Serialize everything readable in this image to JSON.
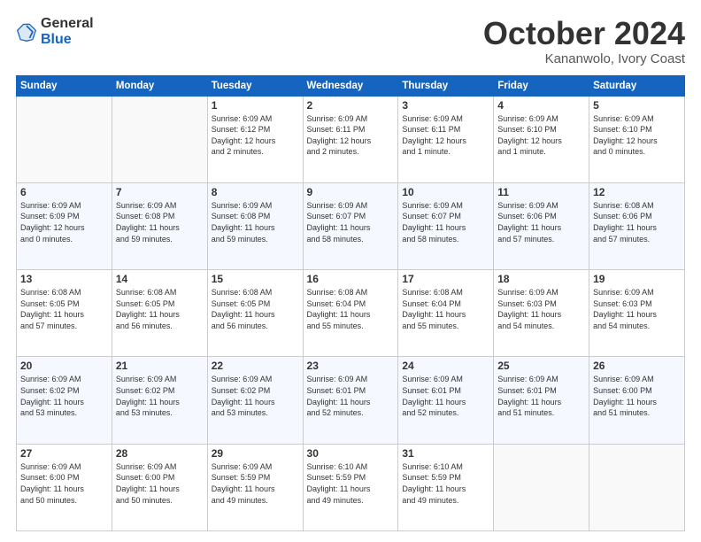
{
  "header": {
    "logo_line1": "General",
    "logo_line2": "Blue",
    "month": "October 2024",
    "location": "Kananwolo, Ivory Coast"
  },
  "days_of_week": [
    "Sunday",
    "Monday",
    "Tuesday",
    "Wednesday",
    "Thursday",
    "Friday",
    "Saturday"
  ],
  "weeks": [
    [
      {
        "day": "",
        "info": ""
      },
      {
        "day": "",
        "info": ""
      },
      {
        "day": "1",
        "info": "Sunrise: 6:09 AM\nSunset: 6:12 PM\nDaylight: 12 hours\nand 2 minutes."
      },
      {
        "day": "2",
        "info": "Sunrise: 6:09 AM\nSunset: 6:11 PM\nDaylight: 12 hours\nand 2 minutes."
      },
      {
        "day": "3",
        "info": "Sunrise: 6:09 AM\nSunset: 6:11 PM\nDaylight: 12 hours\nand 1 minute."
      },
      {
        "day": "4",
        "info": "Sunrise: 6:09 AM\nSunset: 6:10 PM\nDaylight: 12 hours\nand 1 minute."
      },
      {
        "day": "5",
        "info": "Sunrise: 6:09 AM\nSunset: 6:10 PM\nDaylight: 12 hours\nand 0 minutes."
      }
    ],
    [
      {
        "day": "6",
        "info": "Sunrise: 6:09 AM\nSunset: 6:09 PM\nDaylight: 12 hours\nand 0 minutes."
      },
      {
        "day": "7",
        "info": "Sunrise: 6:09 AM\nSunset: 6:08 PM\nDaylight: 11 hours\nand 59 minutes."
      },
      {
        "day": "8",
        "info": "Sunrise: 6:09 AM\nSunset: 6:08 PM\nDaylight: 11 hours\nand 59 minutes."
      },
      {
        "day": "9",
        "info": "Sunrise: 6:09 AM\nSunset: 6:07 PM\nDaylight: 11 hours\nand 58 minutes."
      },
      {
        "day": "10",
        "info": "Sunrise: 6:09 AM\nSunset: 6:07 PM\nDaylight: 11 hours\nand 58 minutes."
      },
      {
        "day": "11",
        "info": "Sunrise: 6:09 AM\nSunset: 6:06 PM\nDaylight: 11 hours\nand 57 minutes."
      },
      {
        "day": "12",
        "info": "Sunrise: 6:08 AM\nSunset: 6:06 PM\nDaylight: 11 hours\nand 57 minutes."
      }
    ],
    [
      {
        "day": "13",
        "info": "Sunrise: 6:08 AM\nSunset: 6:05 PM\nDaylight: 11 hours\nand 57 minutes."
      },
      {
        "day": "14",
        "info": "Sunrise: 6:08 AM\nSunset: 6:05 PM\nDaylight: 11 hours\nand 56 minutes."
      },
      {
        "day": "15",
        "info": "Sunrise: 6:08 AM\nSunset: 6:05 PM\nDaylight: 11 hours\nand 56 minutes."
      },
      {
        "day": "16",
        "info": "Sunrise: 6:08 AM\nSunset: 6:04 PM\nDaylight: 11 hours\nand 55 minutes."
      },
      {
        "day": "17",
        "info": "Sunrise: 6:08 AM\nSunset: 6:04 PM\nDaylight: 11 hours\nand 55 minutes."
      },
      {
        "day": "18",
        "info": "Sunrise: 6:09 AM\nSunset: 6:03 PM\nDaylight: 11 hours\nand 54 minutes."
      },
      {
        "day": "19",
        "info": "Sunrise: 6:09 AM\nSunset: 6:03 PM\nDaylight: 11 hours\nand 54 minutes."
      }
    ],
    [
      {
        "day": "20",
        "info": "Sunrise: 6:09 AM\nSunset: 6:02 PM\nDaylight: 11 hours\nand 53 minutes."
      },
      {
        "day": "21",
        "info": "Sunrise: 6:09 AM\nSunset: 6:02 PM\nDaylight: 11 hours\nand 53 minutes."
      },
      {
        "day": "22",
        "info": "Sunrise: 6:09 AM\nSunset: 6:02 PM\nDaylight: 11 hours\nand 53 minutes."
      },
      {
        "day": "23",
        "info": "Sunrise: 6:09 AM\nSunset: 6:01 PM\nDaylight: 11 hours\nand 52 minutes."
      },
      {
        "day": "24",
        "info": "Sunrise: 6:09 AM\nSunset: 6:01 PM\nDaylight: 11 hours\nand 52 minutes."
      },
      {
        "day": "25",
        "info": "Sunrise: 6:09 AM\nSunset: 6:01 PM\nDaylight: 11 hours\nand 51 minutes."
      },
      {
        "day": "26",
        "info": "Sunrise: 6:09 AM\nSunset: 6:00 PM\nDaylight: 11 hours\nand 51 minutes."
      }
    ],
    [
      {
        "day": "27",
        "info": "Sunrise: 6:09 AM\nSunset: 6:00 PM\nDaylight: 11 hours\nand 50 minutes."
      },
      {
        "day": "28",
        "info": "Sunrise: 6:09 AM\nSunset: 6:00 PM\nDaylight: 11 hours\nand 50 minutes."
      },
      {
        "day": "29",
        "info": "Sunrise: 6:09 AM\nSunset: 5:59 PM\nDaylight: 11 hours\nand 49 minutes."
      },
      {
        "day": "30",
        "info": "Sunrise: 6:10 AM\nSunset: 5:59 PM\nDaylight: 11 hours\nand 49 minutes."
      },
      {
        "day": "31",
        "info": "Sunrise: 6:10 AM\nSunset: 5:59 PM\nDaylight: 11 hours\nand 49 minutes."
      },
      {
        "day": "",
        "info": ""
      },
      {
        "day": "",
        "info": ""
      }
    ]
  ]
}
